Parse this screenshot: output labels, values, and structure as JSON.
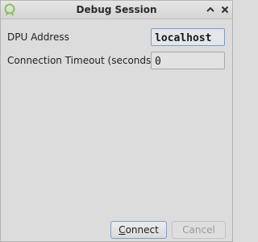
{
  "window": {
    "title": "Debug Session",
    "icons": {
      "app": "app-icon",
      "maximize": "chevron-up-icon",
      "close": "close-icon"
    }
  },
  "form": {
    "address_label": "DPU Address",
    "address_value": "localhost",
    "timeout_label": "Connection Timeout (seconds)",
    "timeout_value": "0"
  },
  "buttons": {
    "connect_mnemonic": "C",
    "connect_rest": "onnect",
    "cancel": "Cancel"
  },
  "colors": {
    "background": "#dcdcdc",
    "focus_border": "#7a9cc6",
    "app_icon": "#8dbf5b"
  }
}
